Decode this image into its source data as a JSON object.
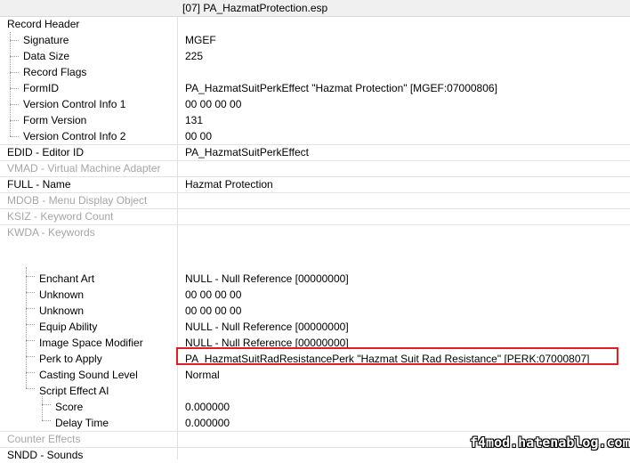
{
  "window": {
    "title": "[07] PA_HazmatProtection.esp"
  },
  "rows": {
    "record_header": {
      "label": "Record Header",
      "value": ""
    },
    "signature": {
      "label": "Signature",
      "value": "MGEF"
    },
    "data_size": {
      "label": "Data Size",
      "value": "225"
    },
    "record_flags": {
      "label": "Record Flags",
      "value": ""
    },
    "formid": {
      "label": "FormID",
      "value": "PA_HazmatSuitPerkEffect \"Hazmat Protection\" [MGEF:07000806]"
    },
    "vci1": {
      "label": "Version Control Info 1",
      "value": "00 00 00 00"
    },
    "form_version": {
      "label": "Form Version",
      "value": "131"
    },
    "vci2": {
      "label": "Version Control Info 2",
      "value": "00 00"
    },
    "edid": {
      "label": "EDID - Editor ID",
      "value": "PA_HazmatSuitPerkEffect"
    },
    "vmad": {
      "label": "VMAD - Virtual Machine Adapter",
      "value": ""
    },
    "full": {
      "label": "FULL - Name",
      "value": "Hazmat Protection"
    },
    "mdob": {
      "label": "MDOB - Menu Display Object",
      "value": ""
    },
    "ksiz": {
      "label": "KSIZ - Keyword Count",
      "value": ""
    },
    "kwda": {
      "label": "KWDA - Keywords",
      "value": ""
    },
    "enchant_art": {
      "label": "Enchant Art",
      "value": "NULL - Null Reference [00000000]"
    },
    "unknown1": {
      "label": "Unknown",
      "value": "00 00 00 00"
    },
    "unknown2": {
      "label": "Unknown",
      "value": "00 00 00 00"
    },
    "equip_ability": {
      "label": "Equip Ability",
      "value": "NULL - Null Reference [00000000]"
    },
    "image_space": {
      "label": "Image Space Modifier",
      "value": "NULL - Null Reference [00000000]"
    },
    "perk_to_apply": {
      "label": "Perk to Apply",
      "value": "PA_HazmatSuitRadResistancePerk \"Hazmat Suit Rad Resistance\" [PERK:07000807]"
    },
    "casting_sound": {
      "label": "Casting Sound Level",
      "value": "Normal"
    },
    "script_effect_ai": {
      "label": "Script Effect AI",
      "value": ""
    },
    "score": {
      "label": "Score",
      "value": "0.000000"
    },
    "delay_time": {
      "label": "Delay Time",
      "value": "0.000000"
    },
    "counter_effects": {
      "label": "Counter Effects",
      "value": ""
    },
    "sndd": {
      "label": "SNDD - Sounds",
      "value": ""
    }
  },
  "watermark": "f4mod.hatenablog.com"
}
